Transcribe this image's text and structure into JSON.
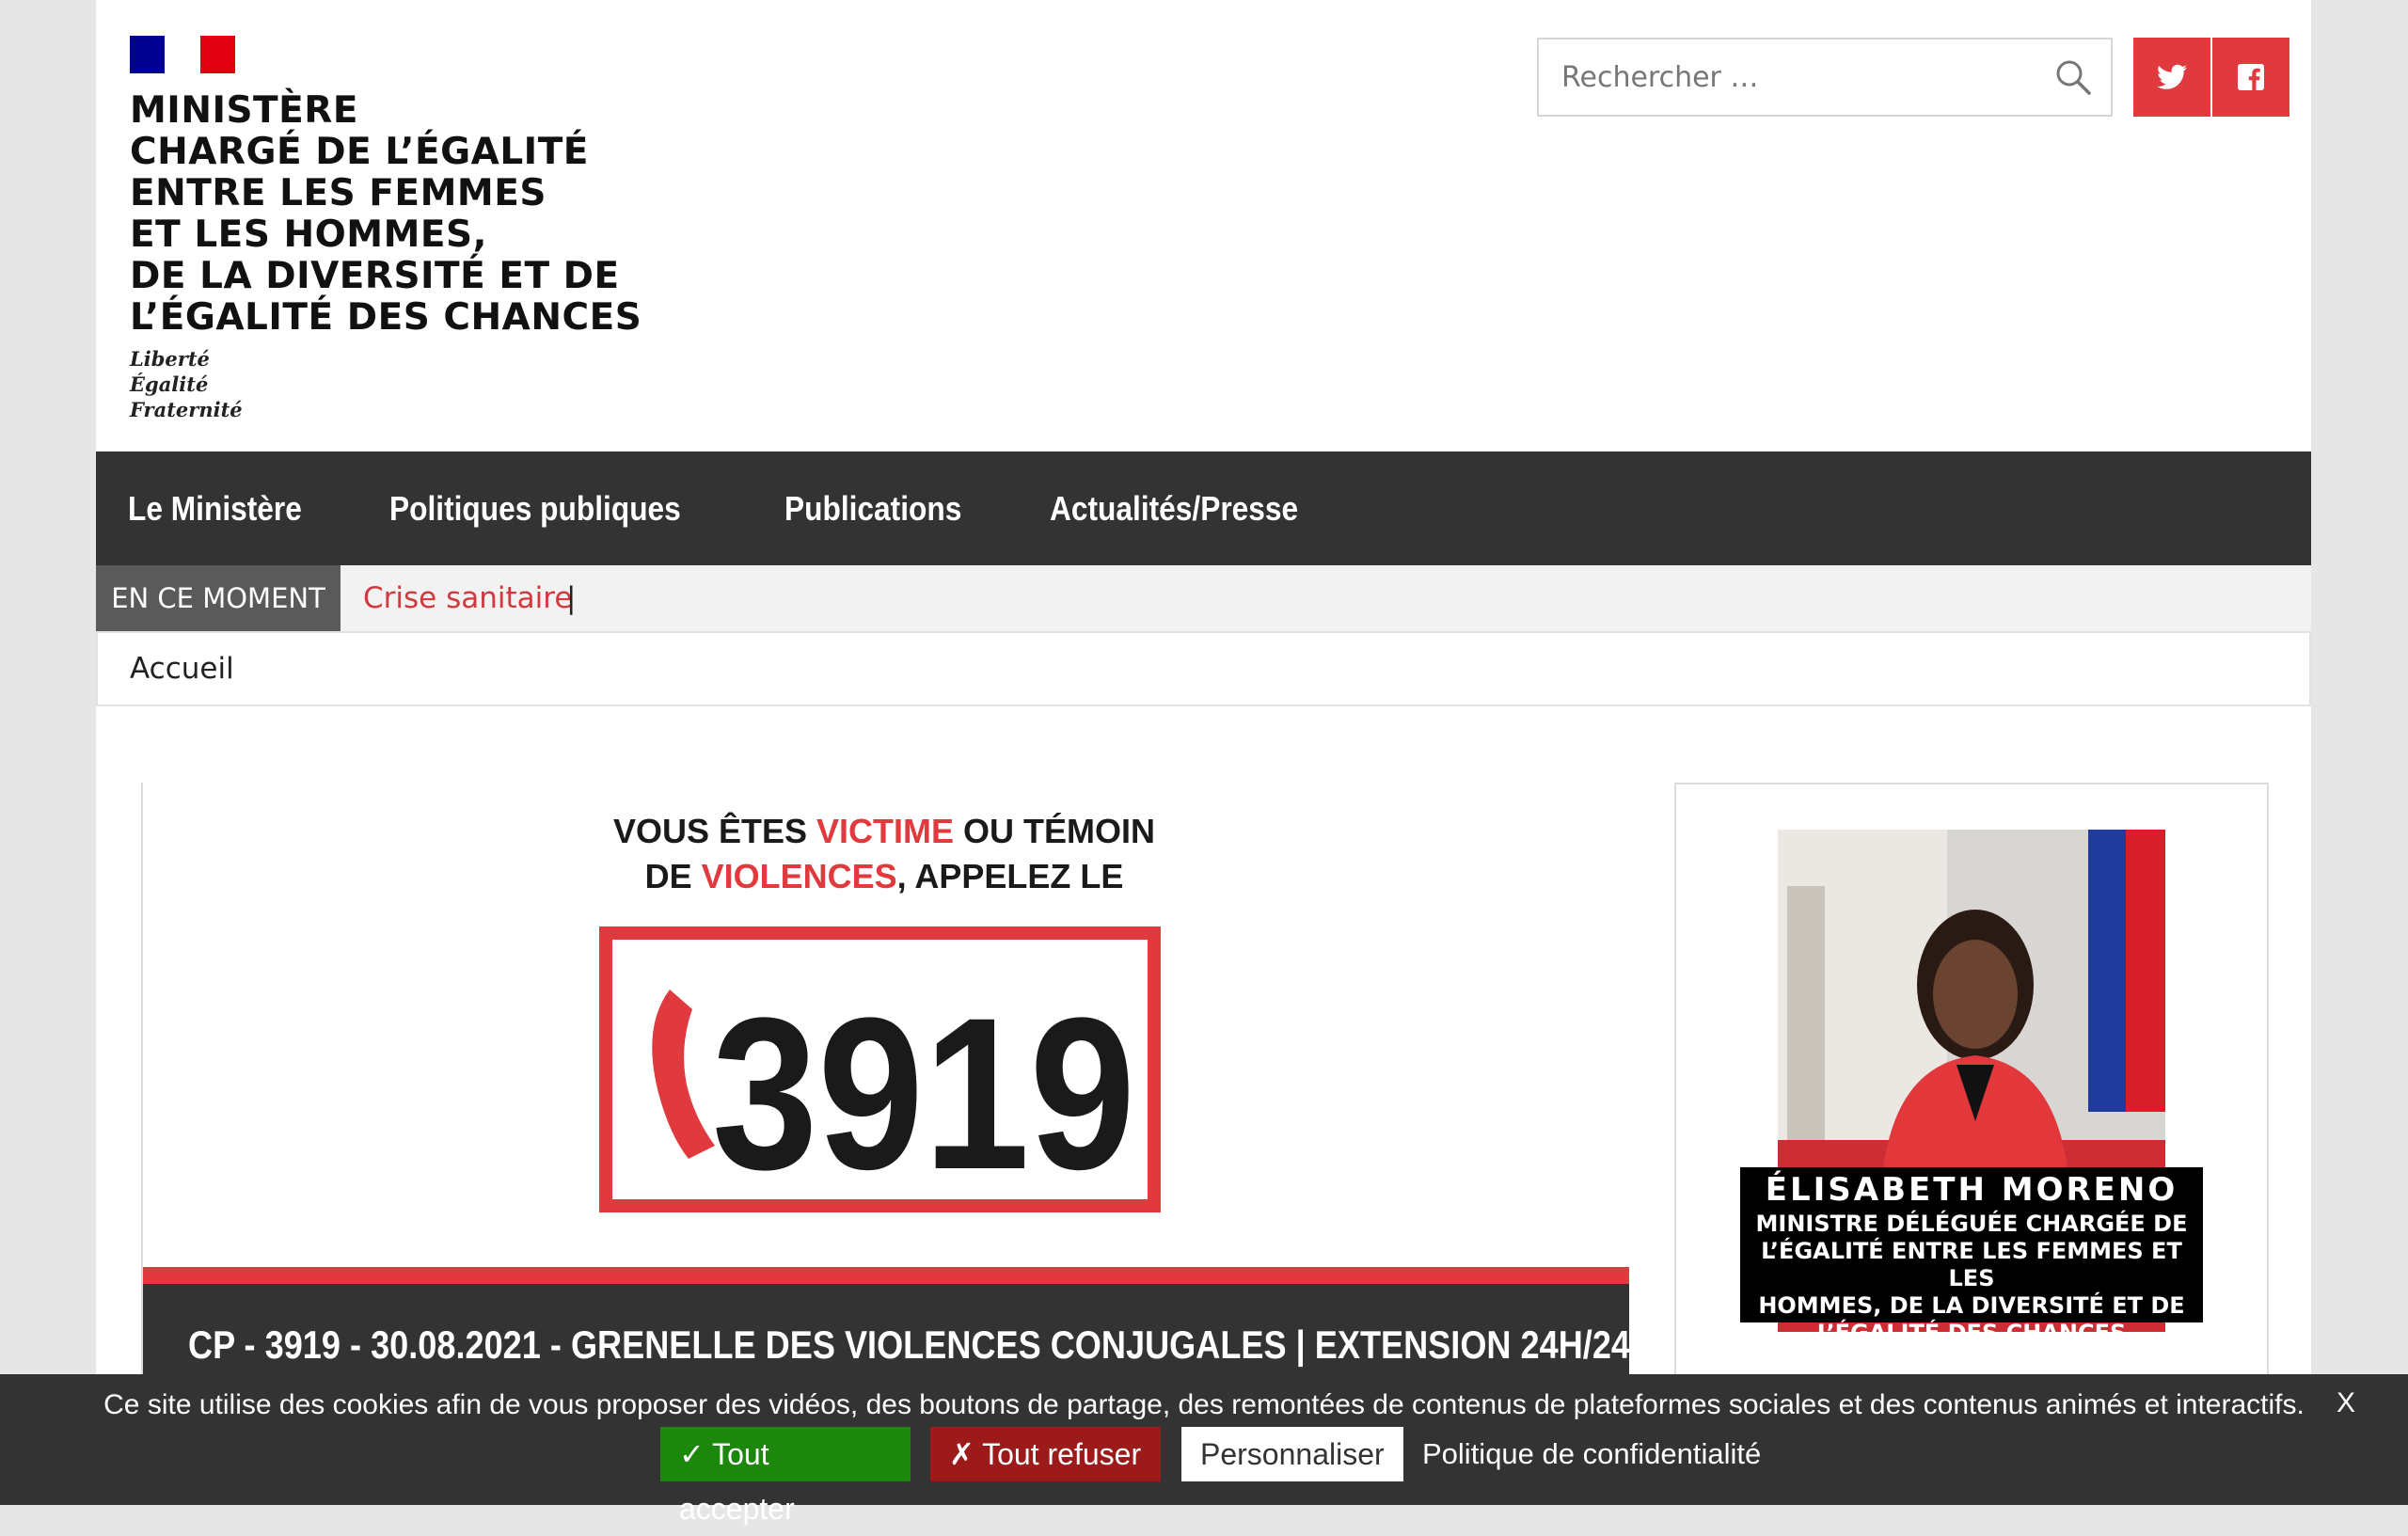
{
  "header": {
    "logo_name": "MINISTÈRE\nCHARGÉ DE L’ÉGALITÉ\nENTRE LES FEMMES\nET LES HOMMES,\nDE LA DIVERSITÉ ET DE\nL’ÉGALITÉ DES CHANCES",
    "motto": "Liberté\nÉgalité\nFraternité",
    "search_placeholder": "Rechercher …",
    "social": [
      "twitter-icon",
      "facebook-icon"
    ],
    "accent": "#e03a3e"
  },
  "nav": {
    "items": [
      "Le Ministère",
      "Politiques publiques",
      "Publications",
      "Actualités/Presse"
    ]
  },
  "ticker": {
    "label": "EN CE MOMENT",
    "link": "Crise sanitaire",
    "separator": "|"
  },
  "breadcrumb": {
    "home": "Accueil"
  },
  "article": {
    "poster_line1_a": "VOUS ÊTES ",
    "poster_line1_b": "VICTIME",
    "poster_line1_c": " OU TÉMOIN",
    "poster_line2_a": "DE ",
    "poster_line2_b": "VIOLENCES",
    "poster_line2_c": ", APPELEZ LE",
    "poster_number": "3919",
    "title": "CP - 3919 - 30.08.2021 - GRENELLE DES VIOLENCES CONJUGALES | EXTENSION 24H/24"
  },
  "sidebar": {
    "name": "ÉLISABETH MORENO",
    "role": "MINISTRE DÉLÉGUÉE CHARGÉE DE\nL’ÉGALITÉ ENTRE LES FEMMES ET LES\nHOMMES, DE LA DIVERSITÉ ET DE\nL’ÉGALITÉ DES CHANCES"
  },
  "cookie": {
    "message": "Ce site utilise des cookies afin de vous proposer des vidéos, des boutons de partage, des remontées de contenus de plateformes sociales et des contenus animés et interactifs.",
    "close": "X",
    "accept": "✓ Tout accepter",
    "deny": "✗ Tout refuser",
    "customize": "Personnaliser",
    "policy": "Politique de confidentialité"
  }
}
